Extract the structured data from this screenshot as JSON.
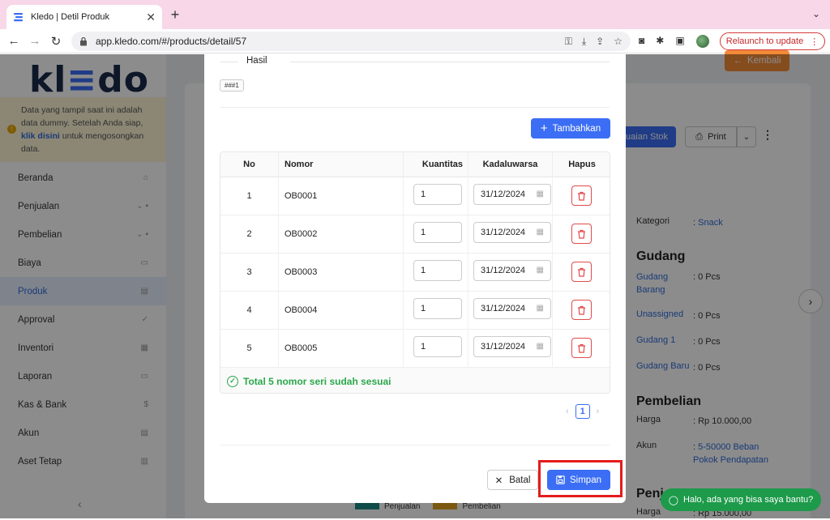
{
  "browser": {
    "tab_title": "Kledo | Detil Produk",
    "url": "app.kledo.com/#/products/detail/57",
    "relaunch_label": "Relaunch to update"
  },
  "sidebar": {
    "logo": "kledo",
    "dummy_note_pre": "Data yang tampil saat ini adalah data dummy. Setelah Anda siap,",
    "dummy_note_link": "klik disini",
    "dummy_note_post": "untuk mengosongkan data.",
    "items": [
      {
        "label": "Beranda"
      },
      {
        "label": "Penjualan"
      },
      {
        "label": "Pembelian"
      },
      {
        "label": "Biaya"
      },
      {
        "label": "Produk"
      },
      {
        "label": "Approval"
      },
      {
        "label": "Inventori"
      },
      {
        "label": "Laporan"
      },
      {
        "label": "Kas & Bank"
      },
      {
        "label": "Akun"
      },
      {
        "label": "Aset Tetap"
      }
    ]
  },
  "background": {
    "back_label": "Kembali",
    "adjust_label": "uaian Stok",
    "print_label": "Print",
    "kategori_key": "Kategori",
    "kategori_value": "Snack",
    "gudang_title": "Gudang",
    "gudang_rows": [
      {
        "key": "Gudang Barang",
        "value": ": 0 Pcs"
      },
      {
        "key": "Unassigned",
        "value": ": 0 Pcs"
      },
      {
        "key": "Gudang 1",
        "value": ": 0 Pcs"
      },
      {
        "key": "Gudang Baru",
        "value": ": 0 Pcs"
      }
    ],
    "pembelian_title": "Pembelian",
    "harga_key": "Harga",
    "harga_value": ": Rp 10.000,00",
    "akun_key": "Akun",
    "akun_value": "5-50000 Beban Pokok Pendapatan",
    "penjualan_title": "Penj",
    "harga2_value": ": Rp 15.000,00",
    "legend": [
      "Penjualan",
      "Pembelian"
    ],
    "chat_label": "Halo, ada yang bisa saya bantu?"
  },
  "modal": {
    "hasil_label": "Hasil",
    "code_chip": "###1",
    "add_label": "Tambahkan",
    "headers": {
      "no": "No",
      "nomor": "Nomor",
      "kuantitas": "Kuantitas",
      "kadaluwarsa": "Kadaluwarsa",
      "hapus": "Hapus"
    },
    "rows": [
      {
        "no": "1",
        "nomor": "OB0001",
        "qty": "1",
        "date": "31/12/2024"
      },
      {
        "no": "2",
        "nomor": "OB0002",
        "qty": "1",
        "date": "31/12/2024"
      },
      {
        "no": "3",
        "nomor": "OB0003",
        "qty": "1",
        "date": "31/12/2024"
      },
      {
        "no": "4",
        "nomor": "OB0004",
        "qty": "1",
        "date": "31/12/2024"
      },
      {
        "no": "5",
        "nomor": "OB0005",
        "qty": "1",
        "date": "31/12/2024"
      }
    ],
    "summary": "Total 5 nomor seri sudah sesuai",
    "page": "1",
    "cancel_label": "Batal",
    "save_label": "Simpan"
  },
  "colors": {
    "primary": "#3b6ef5",
    "success": "#2aa84a",
    "danger": "#e24b4b",
    "highlight": "#e41b1b"
  }
}
